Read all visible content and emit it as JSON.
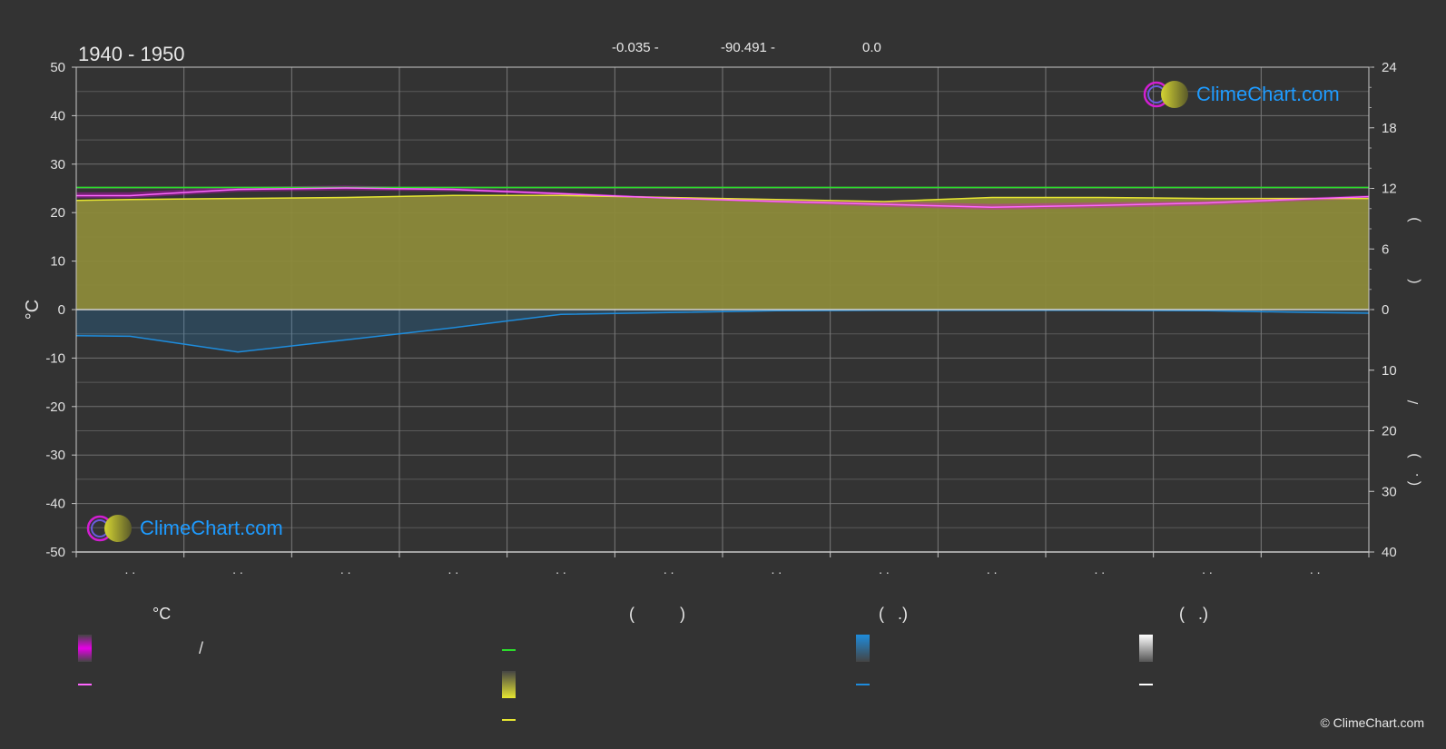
{
  "header": {
    "period": "1940 - 1950",
    "latitude": "-0.035 -",
    "longitude": "-90.491 -",
    "elevation": "0.0"
  },
  "brand": {
    "logo_text": "ClimeChart.com",
    "copyright": "© ClimeChart.com"
  },
  "legend": {
    "group_temp_heading": "°C",
    "temp_range_separator": "/",
    "group_sun_heading": "(          )",
    "group_rain_heading": "(   .)",
    "group_snow_heading": "(   .)"
  },
  "colors": {
    "background": "#333333",
    "daylight": "#2bdc2b",
    "sunshine": "#e6e632",
    "sunshine_fill": "#8c8a3a",
    "temp_range": "#e600e6",
    "temp_mean": "#ff66ff",
    "rain": "#1e8cdc",
    "snow": "#ffffff",
    "grid": "#6a6a6a",
    "axis_text": "#e0e0e0",
    "brand_blue": "#1e9bff"
  },
  "chart_data": {
    "type": "line",
    "months": 12,
    "month_labels": [
      ". .",
      ". .",
      ". .",
      ". .",
      ". .",
      ". .",
      ". .",
      ". .",
      ". .",
      ". .",
      ". .",
      ". ."
    ],
    "left_axis": {
      "label": "°C",
      "range": [
        -50,
        50
      ],
      "ticks": [
        50,
        40,
        30,
        20,
        10,
        0,
        -10,
        -20,
        -30,
        -40,
        -50
      ]
    },
    "right_axis_top": {
      "range": [
        0,
        24
      ],
      "ticks": [
        24,
        18,
        12,
        6,
        0
      ],
      "label_fragments": [
        ")",
        "("
      ]
    },
    "right_axis_bottom": {
      "range": [
        0,
        40
      ],
      "ticks": [
        0,
        10,
        20,
        30,
        40
      ],
      "label_fragments": [
        "/",
        ")",
        "( ."
      ]
    },
    "series": [
      {
        "key": "daylight_hours",
        "axis": "hours",
        "x": [
          0.5,
          1.5,
          2.5,
          3.5,
          4.5,
          5.5,
          6.5,
          7.5,
          8.5,
          9.5,
          10.5,
          11.5
        ],
        "values": [
          12.1,
          12.1,
          12.1,
          12.1,
          12.1,
          12.1,
          12.1,
          12.1,
          12.1,
          12.1,
          12.1,
          12.1
        ]
      },
      {
        "key": "sunshine_hours",
        "axis": "hours",
        "x": [
          0,
          0.5,
          1.5,
          2.5,
          3.5,
          4.5,
          5.5,
          6.5,
          7.5,
          8.5,
          9.5,
          10.5,
          11.5,
          12
        ],
        "values": [
          10.8,
          10.9,
          11.0,
          11.1,
          11.3,
          11.3,
          11.1,
          10.9,
          10.7,
          11.1,
          11.1,
          11.0,
          11.0,
          11.0
        ]
      },
      {
        "key": "temp_max_mean",
        "axis": "temp",
        "x": [
          0,
          0.5,
          1.5,
          2.5,
          3.5,
          4.5,
          5.5,
          6.5,
          7.5,
          8.5,
          9.5,
          10.5,
          11.5,
          12
        ],
        "values": [
          24.2,
          24.2,
          25.3,
          25.6,
          25.1,
          24.2,
          23.2,
          22.7,
          22.3,
          21.8,
          22.1,
          22.4,
          23.2,
          23.6
        ]
      },
      {
        "key": "temp_mean",
        "axis": "temp",
        "x": [
          0,
          0.5,
          1.5,
          2.5,
          3.5,
          4.5,
          5.5,
          6.5,
          7.5,
          8.5,
          9.5,
          10.5,
          11.5,
          12
        ],
        "values": [
          23.5,
          23.5,
          24.8,
          25.1,
          24.8,
          23.9,
          23.0,
          22.3,
          21.7,
          21.1,
          21.5,
          22.0,
          22.9,
          23.3
        ]
      },
      {
        "key": "temp_min_mean",
        "axis": "temp",
        "x": [
          0,
          0.5,
          1.5,
          2.5,
          3.5,
          4.5,
          5.5,
          6.5,
          7.5,
          8.5,
          9.5,
          10.5,
          11.5,
          12
        ],
        "values": [
          23.0,
          23.0,
          24.3,
          24.6,
          24.4,
          23.6,
          22.8,
          22.0,
          21.2,
          20.6,
          21.0,
          21.5,
          22.5,
          22.8
        ]
      },
      {
        "key": "precipitation_mean",
        "axis": "mm",
        "x": [
          0,
          0.5,
          1.5,
          2.5,
          3.5,
          4.5,
          5.5,
          6.5,
          7.5,
          8.5,
          9.5,
          10.5,
          11.5,
          12
        ],
        "values": [
          4.3,
          4.4,
          7.0,
          5.0,
          3.0,
          0.8,
          0.5,
          0.2,
          0.1,
          0.1,
          0.1,
          0.2,
          0.5,
          0.6
        ]
      },
      {
        "key": "snowfall_mean",
        "axis": "mm",
        "x": [
          0,
          12
        ],
        "values": [
          0,
          0
        ]
      }
    ]
  }
}
